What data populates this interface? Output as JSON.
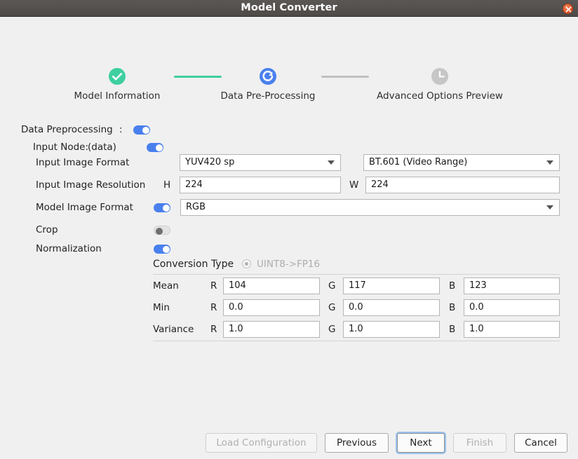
{
  "window": {
    "title": "Model Converter",
    "close_icon": "close-icon"
  },
  "stepper": {
    "steps": [
      {
        "label": "Model Information",
        "icon": "check-circle-icon",
        "state": "complete",
        "color": "#3ecfa0"
      },
      {
        "label": "Data Pre-Processing",
        "icon": "refresh-circle-icon",
        "state": "current",
        "color": "#4a80ee"
      },
      {
        "label": "Advanced Options  Preview",
        "icon": "clock-circle-icon",
        "state": "pending",
        "color": "#c6c6c6"
      }
    ],
    "connectors": [
      {
        "color": "#3ecfa0"
      },
      {
        "color": "#c0c0c0"
      }
    ]
  },
  "form": {
    "data_preprocessing": {
      "label": "Data Preprocessing",
      "separator": ":",
      "toggle_state": "on"
    },
    "input_node": {
      "label": "Input Node:",
      "value": "(data)",
      "toggle_state": "on"
    },
    "input_image_format": {
      "label": "Input Image Format",
      "format_value": "YUV420 sp",
      "range_value": "BT.601 (Video Range)"
    },
    "input_image_resolution": {
      "label": "Input Image Resolution",
      "h_label": "H",
      "h_value": "224",
      "w_label": "W",
      "w_value": "224"
    },
    "model_image_format": {
      "label": "Model Image Format",
      "toggle_state": "on",
      "value": "RGB"
    },
    "crop": {
      "label": "Crop",
      "toggle_state": "off"
    },
    "normalization": {
      "label": "Normalization",
      "toggle_state": "on"
    },
    "conversion_type": {
      "label": "Conversion Type",
      "option_label": "UINT8->FP16",
      "selected": true,
      "enabled": false
    },
    "channels": {
      "r_label": "R",
      "g_label": "G",
      "b_label": "B"
    },
    "mean": {
      "label": "Mean",
      "r": "104",
      "g": "117",
      "b": "123"
    },
    "min": {
      "label": "Min",
      "r": "0.0",
      "g": "0.0",
      "b": "0.0"
    },
    "variance": {
      "label": "Variance",
      "r": "1.0",
      "g": "1.0",
      "b": "1.0"
    }
  },
  "buttons": {
    "load_configuration": {
      "label": "Load Configuration",
      "enabled": false
    },
    "previous": {
      "label": "Previous",
      "enabled": true
    },
    "next": {
      "label": "Next",
      "enabled": true,
      "focused": true
    },
    "finish": {
      "label": "Finish",
      "enabled": false
    },
    "cancel": {
      "label": "Cancel",
      "enabled": true
    }
  }
}
